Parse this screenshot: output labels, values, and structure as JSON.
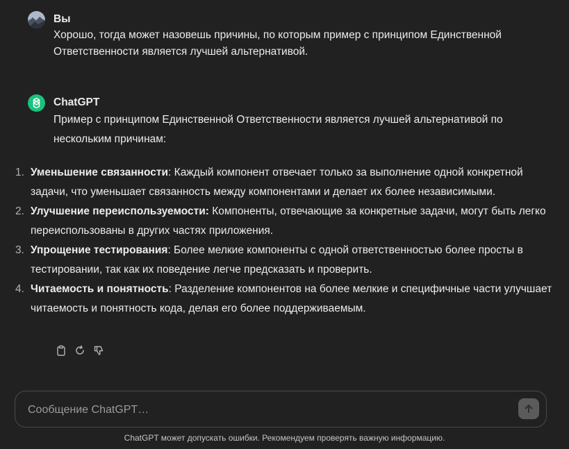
{
  "user_message": {
    "author": "Вы",
    "text": "Хорошо, тогда может назовешь причины, по которым пример с принципом Единственной Ответственности является лучшей альтернативой."
  },
  "assistant_message": {
    "author": "ChatGPT",
    "intro": "Пример с принципом Единственной Ответственности является лучшей альтернативой по нескольким причинам:",
    "items": [
      {
        "num": "1.",
        "title": "Уменьшение связанности",
        "text": ": Каждый компонент отвечает только за выполнение одной конкретной задачи, что уменьшает связанность между компонентами и делает их более независимыми."
      },
      {
        "num": "2.",
        "title": "Улучшение переиспользуемости:",
        "text": " Компоненты, отвечающие за конкретные задачи, могут быть легко переиспользованы в других частях приложения."
      },
      {
        "num": "3.",
        "title": "Упрощение тестирования",
        "text": ": Более мелкие компоненты с одной ответственностью более просты в тестировании, так как их поведение легче предсказать и проверить."
      },
      {
        "num": "4.",
        "title": "Читаемость и понятность",
        "text": ": Разделение компонентов на более мелкие и специфичные части улучшает читаемость и понятность кода, делая его более поддерживаемым."
      }
    ],
    "actions": [
      "copy-icon",
      "regenerate-icon",
      "thumbs-down-icon"
    ]
  },
  "composer": {
    "placeholder": "Сообщение ChatGPT…",
    "send_icon": "arrow-up-icon"
  },
  "disclaimer": "ChatGPT может допускать ошибки. Рекомендуем проверять важную информацию.",
  "colors": {
    "background": "#212121",
    "text": "#ececec",
    "assistant_avatar": "#19c37d",
    "border": "#4a4a4a"
  }
}
